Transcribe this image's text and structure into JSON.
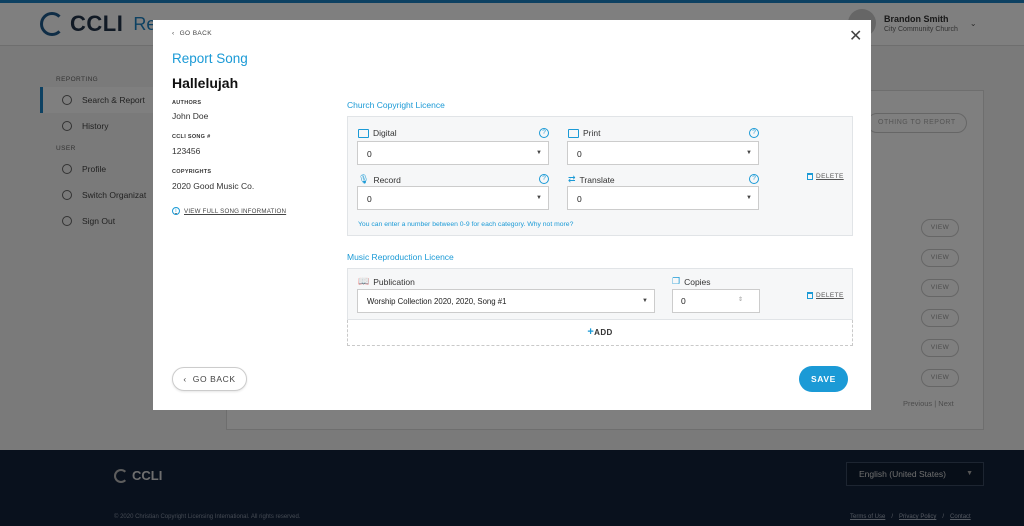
{
  "app": {
    "logo_text": "CCLI",
    "page_title_fragment": "Rep"
  },
  "user": {
    "name": "Brandon Smith",
    "org": "City Community Church"
  },
  "sidebar": {
    "section_reporting": "REPORTING",
    "section_user": "USER",
    "items": [
      {
        "label": "Search & Report",
        "icon": "search-icon",
        "active": true
      },
      {
        "label": "History",
        "icon": "history-icon"
      },
      {
        "label": "Profile",
        "icon": "profile-icon"
      },
      {
        "label": "Switch Organizat",
        "icon": "switch-icon"
      },
      {
        "label": "Sign Out",
        "icon": "sign-out-icon"
      }
    ]
  },
  "background": {
    "nothing_to_report": "OTHING TO REPORT",
    "view_label": "VIEW",
    "pager": "Previous | Next"
  },
  "modal": {
    "go_back_top": "GO BACK",
    "title": "Report Song",
    "song_title": "Hallelujah",
    "authors_label": "AUTHORS",
    "authors_value": "John Doe",
    "song_number_label": "CCLI SONG #",
    "song_number_value": "123456",
    "copyrights_label": "COPYRIGHTS",
    "copyrights_value": "2020 Good Music Co.",
    "view_full_info": "VIEW FULL SONG INFORMATION",
    "ccl_section": "Church Copyright Licence",
    "ccl_fields": {
      "digital": {
        "label": "Digital",
        "value": "0"
      },
      "print": {
        "label": "Print",
        "value": "0"
      },
      "record": {
        "label": "Record",
        "value": "0"
      },
      "translate": {
        "label": "Translate",
        "value": "0"
      }
    },
    "help_glyph": "?",
    "delete_label": "DELETE",
    "ccl_note": "You can enter a number between 0-9 for each category. Why not more?",
    "mrl_section": "Music Reproduction Licence",
    "publication_label": "Publication",
    "publication_value": "Worship Collection 2020, 2020, Song #1",
    "copies_label": "Copies",
    "copies_value": "0",
    "add_label": "ADD",
    "go_back_button": "GO BACK",
    "save_button": "SAVE"
  },
  "footer": {
    "logo_text": "CCLI",
    "language": "English (United States)",
    "copyright": "© 2020 Christian Copyright Licensing International. All rights reserved.",
    "links": [
      "Terms of Use",
      "Privacy Policy",
      "Contact"
    ]
  },
  "colors": {
    "accent": "#1b9ad6",
    "footer_bg": "#13223a",
    "overlay": "rgba(0,0,0,0.5)"
  }
}
